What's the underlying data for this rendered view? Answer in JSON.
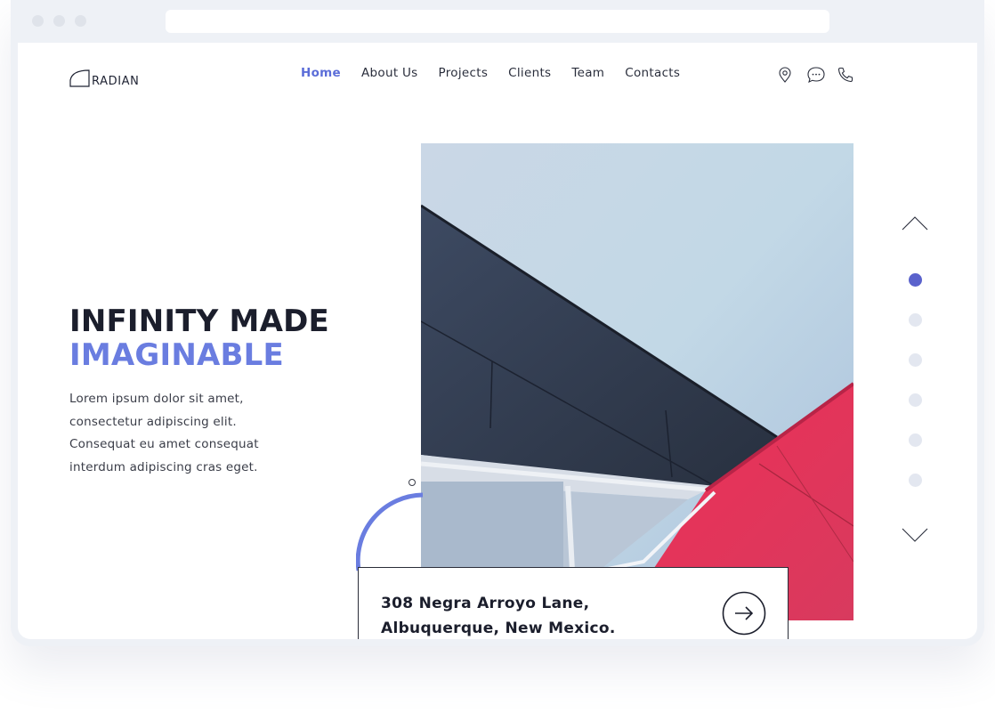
{
  "brand": {
    "name": "RADIAN"
  },
  "nav": {
    "items": [
      {
        "label": "Home",
        "active": true
      },
      {
        "label": "About Us",
        "active": false
      },
      {
        "label": "Projects",
        "active": false
      },
      {
        "label": "Clients",
        "active": false
      },
      {
        "label": "Team",
        "active": false
      },
      {
        "label": "Contacts",
        "active": false
      }
    ]
  },
  "header_icons": [
    "location-pin-icon",
    "chat-bubble-icon",
    "phone-icon"
  ],
  "hero": {
    "title_line1": "INFINITY MADE",
    "title_line2": "IMAGINABLE",
    "description": "Lorem ipsum dolor sit amet, consectetur adipiscing elit. Consequat eu amet consequat interdum adipiscing cras eget."
  },
  "address_card": {
    "line1": "308 Negra Arroyo Lane,",
    "line2": "Albuquerque, New Mexico.",
    "action_icon": "arrow-right-circle-icon"
  },
  "slider": {
    "total": 6,
    "active_index": 0,
    "up_icon": "chevron-up-icon",
    "down_icon": "chevron-down-icon"
  },
  "colors": {
    "accent": "#5b6dd8",
    "title_accent": "#6a7de0",
    "dark": "#1b1e2c",
    "active_dot": "#5a62cc",
    "inactive_dot": "#e3e7f0"
  }
}
